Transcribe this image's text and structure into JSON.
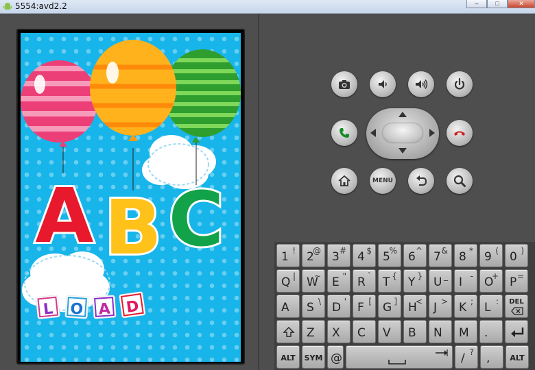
{
  "window": {
    "title": "5554:avd2.2"
  },
  "colors": {
    "screen_bg": "#18b5ea",
    "device_body": "#4e4e4e"
  },
  "game": {
    "letters": [
      "A",
      "B",
      "C"
    ],
    "load_blocks": [
      "L",
      "O",
      "A",
      "D"
    ]
  },
  "controls": {
    "row1": [
      "camera-icon",
      "volume-down-icon",
      "volume-up-icon",
      "power-icon"
    ],
    "row2": [
      "call-icon",
      "dpad",
      "end-call-icon"
    ],
    "row3": [
      "home-icon",
      "menu-button",
      "back-icon",
      "search-icon"
    ],
    "menu_label": "MENU"
  },
  "keyboard": {
    "row1": [
      {
        "main": "1",
        "alt": "!"
      },
      {
        "main": "2",
        "alt": "@"
      },
      {
        "main": "3",
        "alt": "#"
      },
      {
        "main": "4",
        "alt": "$"
      },
      {
        "main": "5",
        "alt": "%"
      },
      {
        "main": "6",
        "alt": "^"
      },
      {
        "main": "7",
        "alt": "&"
      },
      {
        "main": "8",
        "alt": "*"
      },
      {
        "main": "9",
        "alt": "("
      },
      {
        "main": "0",
        "alt": ")"
      }
    ],
    "row2": [
      {
        "main": "Q",
        "alt": "|"
      },
      {
        "main": "W",
        "alt": "~"
      },
      {
        "main": "E",
        "alt": "\""
      },
      {
        "main": "R",
        "alt": "`"
      },
      {
        "main": "T",
        "alt": "{"
      },
      {
        "main": "Y",
        "alt": "}"
      },
      {
        "main": "U",
        "alt": "_"
      },
      {
        "main": "I",
        "alt": "-"
      },
      {
        "main": "O",
        "alt": "+"
      },
      {
        "main": "P",
        "alt": "="
      }
    ],
    "row3": [
      {
        "main": "A",
        "alt": ""
      },
      {
        "main": "S",
        "alt": "\\"
      },
      {
        "main": "D",
        "alt": "'"
      },
      {
        "main": "F",
        "alt": "["
      },
      {
        "main": "G",
        "alt": "]"
      },
      {
        "main": "H",
        "alt": "<"
      },
      {
        "main": "J",
        "alt": ">"
      },
      {
        "main": "K",
        "alt": ";"
      },
      {
        "main": "L",
        "alt": ":"
      }
    ],
    "del": "DEL",
    "row4": [
      {
        "main": "Z",
        "alt": ""
      },
      {
        "main": "X",
        "alt": ""
      },
      {
        "main": "C",
        "alt": ""
      },
      {
        "main": "V",
        "alt": ""
      },
      {
        "main": "B",
        "alt": ""
      },
      {
        "main": "N",
        "alt": ""
      },
      {
        "main": "M",
        "alt": ""
      },
      {
        "main": ".",
        "alt": ""
      }
    ],
    "alt_left": "ALT",
    "sym": "SYM",
    "at": "@",
    "slash": "/",
    "question": "?",
    "comma": ",",
    "alt_right": "ALT"
  }
}
